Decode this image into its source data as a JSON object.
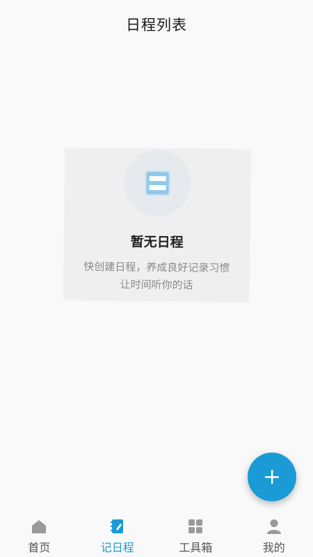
{
  "header": {
    "title": "日程列表"
  },
  "empty_state": {
    "icon": "schedule-list-icon",
    "title": "暂无日程",
    "desc_line1": "快创建日程，养成良好记录习惯",
    "desc_line2": "让时间听你的话"
  },
  "fab": {
    "icon": "plus-icon"
  },
  "tabs": [
    {
      "label": "首页",
      "icon": "home-icon"
    },
    {
      "label": "记日程",
      "icon": "schedule-note-icon",
      "active": true
    },
    {
      "label": "工具箱",
      "icon": "grid-icon"
    },
    {
      "label": "我的",
      "icon": "user-icon"
    }
  ],
  "colors": {
    "accent": "#1a9bd6",
    "inactive": "#9a9a9a",
    "background": "#f9f9f9"
  }
}
